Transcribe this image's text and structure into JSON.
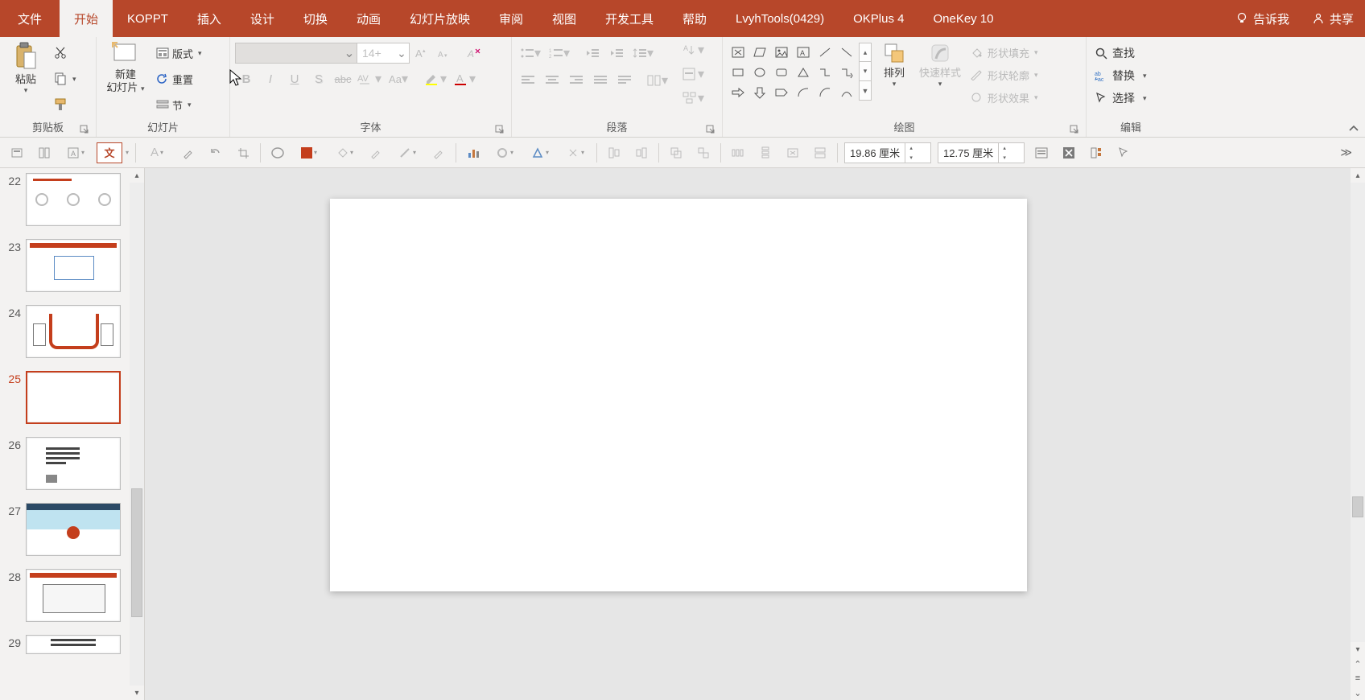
{
  "tabs": {
    "file": "文件",
    "home": "开始",
    "koppt": "KOPPT",
    "insert": "插入",
    "design": "设计",
    "transitions": "切换",
    "animations": "动画",
    "slideshow": "幻灯片放映",
    "review": "审阅",
    "view": "视图",
    "developer": "开发工具",
    "help": "帮助",
    "lvyh": "LvyhTools(0429)",
    "okplus": "OKPlus 4",
    "onekey": "OneKey 10",
    "tellme": "告诉我",
    "share": "共享"
  },
  "groups": {
    "clipboard": {
      "label": "剪贴板",
      "paste": "粘贴"
    },
    "slides": {
      "label": "幻灯片",
      "new_slide_l1": "新建",
      "new_slide_l2": "幻灯片",
      "layout": "版式",
      "reset": "重置",
      "section": "节"
    },
    "font": {
      "label": "字体",
      "size_placeholder": "14+"
    },
    "paragraph": {
      "label": "段落"
    },
    "drawing": {
      "label": "绘图",
      "arrange": "排列",
      "quick_styles": "快速样式",
      "shape_fill": "形状填充",
      "shape_outline": "形状轮廓",
      "shape_effects": "形状效果"
    },
    "editing": {
      "label": "编辑",
      "find": "查找",
      "replace": "替换",
      "select": "选择"
    }
  },
  "toolbar2": {
    "width": "19.86 厘米",
    "height": "12.75 厘米"
  },
  "slides_panel": {
    "items": [
      {
        "num": "22"
      },
      {
        "num": "23"
      },
      {
        "num": "24"
      },
      {
        "num": "25",
        "current": true
      },
      {
        "num": "26"
      },
      {
        "num": "27"
      },
      {
        "num": "28"
      },
      {
        "num": "29"
      }
    ]
  }
}
